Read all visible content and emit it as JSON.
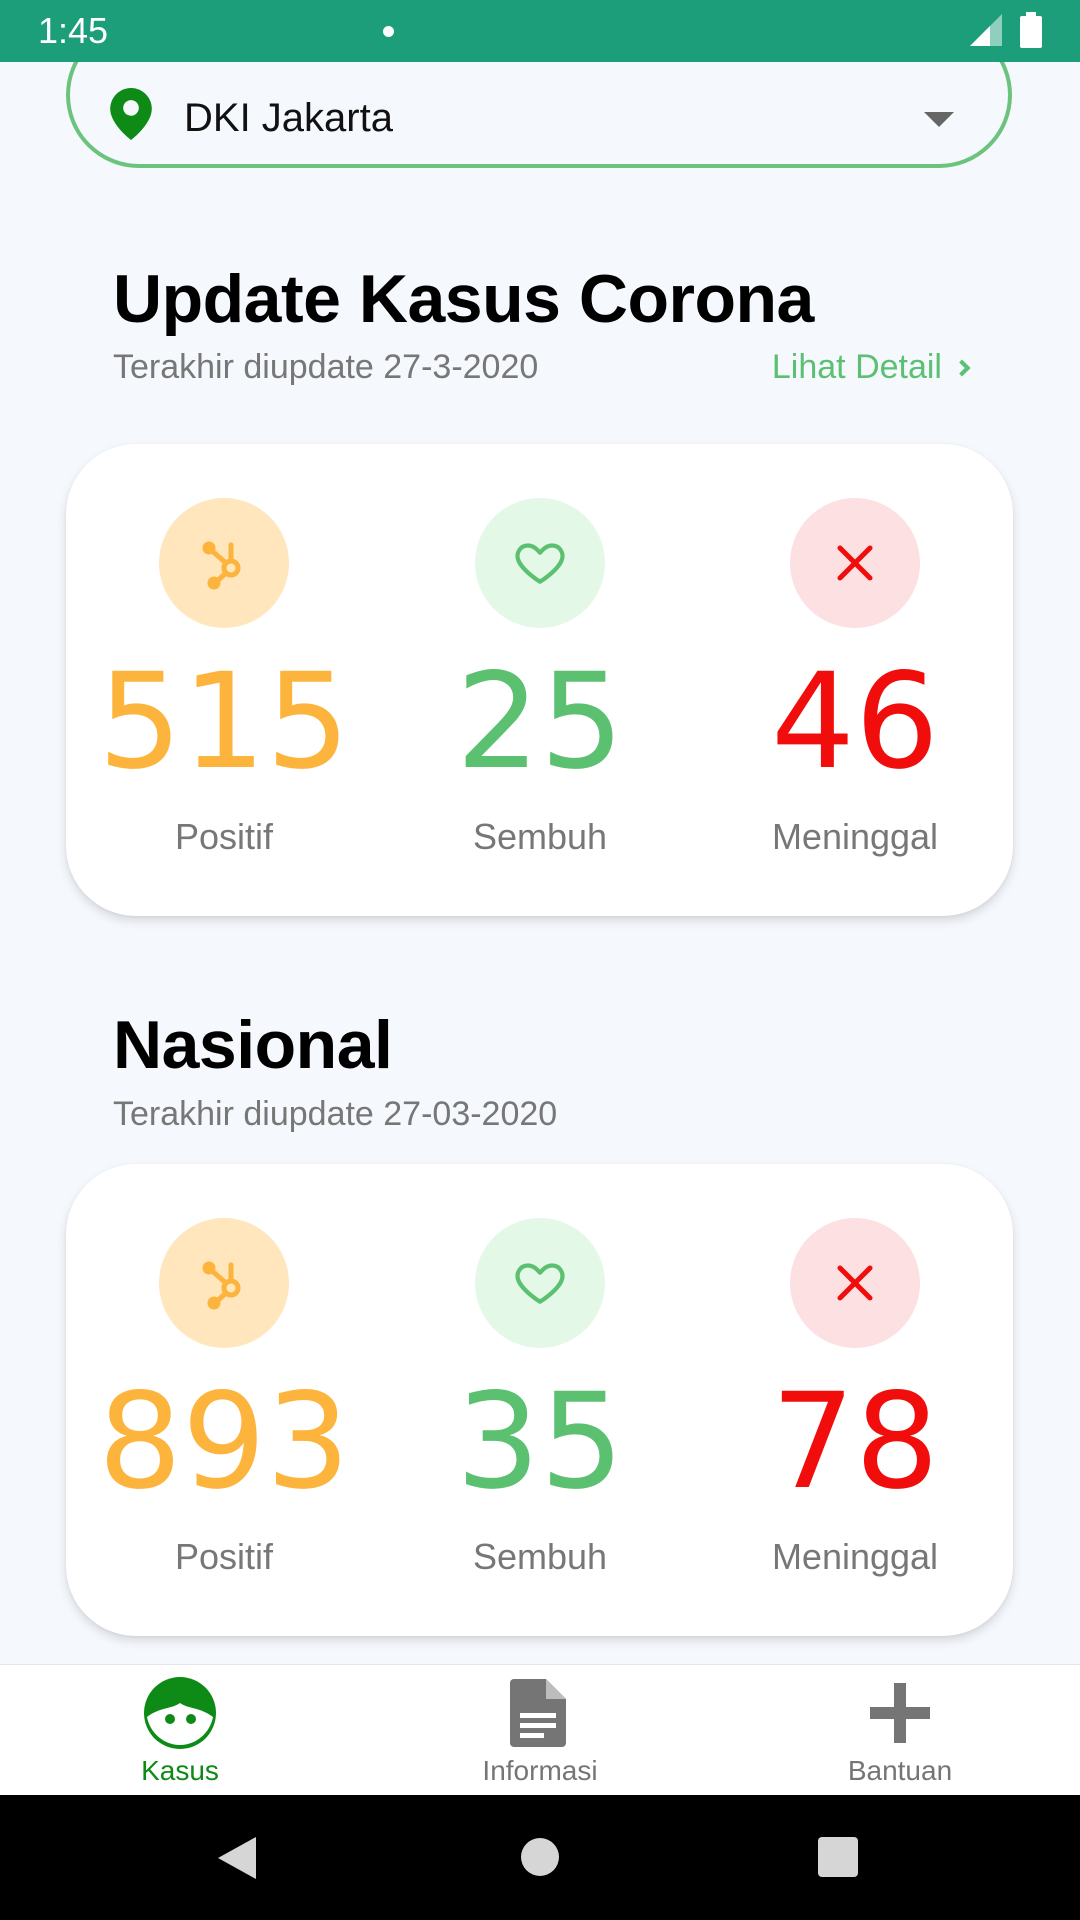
{
  "status_bar": {
    "time": "1:45"
  },
  "location": {
    "selected": "DKI Jakarta"
  },
  "regional": {
    "title": "Update Kasus Corona",
    "updated": "Terakhir diupdate 27-3-2020",
    "detail_link": "Lihat Detail",
    "stats": [
      {
        "value": "515",
        "label": "Positif",
        "icon": "virus-icon",
        "color": "#FDB43C",
        "bg": "#FFE6BC"
      },
      {
        "value": "25",
        "label": "Sembuh",
        "icon": "heart-icon",
        "color": "#5BC070",
        "bg": "#E3F8E6"
      },
      {
        "value": "46",
        "label": "Meninggal",
        "icon": "close-icon",
        "color": "#F20D0D",
        "bg": "#FCE0E2"
      }
    ]
  },
  "national": {
    "title": "Nasional",
    "updated": "Terakhir diupdate 27-03-2020",
    "stats": [
      {
        "value": "893",
        "label": "Positif",
        "icon": "virus-icon",
        "color": "#FDB43C",
        "bg": "#FFE6BC"
      },
      {
        "value": "35",
        "label": "Sembuh",
        "icon": "heart-icon",
        "color": "#5BC070",
        "bg": "#E3F8E6"
      },
      {
        "value": "78",
        "label": "Meninggal",
        "icon": "close-icon",
        "color": "#F20D0D",
        "bg": "#FCE0E2"
      }
    ]
  },
  "bottom_nav": {
    "items": [
      {
        "label": "Kasus",
        "icon": "face-icon",
        "active": true
      },
      {
        "label": "Informasi",
        "icon": "document-icon",
        "active": false
      },
      {
        "label": "Bantuan",
        "icon": "plus-icon",
        "active": false
      }
    ]
  },
  "colors": {
    "status_bar": "#1C9E7A",
    "accent": "#5CC073",
    "nav_active": "#0E8A16",
    "nav_inactive": "#757575"
  }
}
